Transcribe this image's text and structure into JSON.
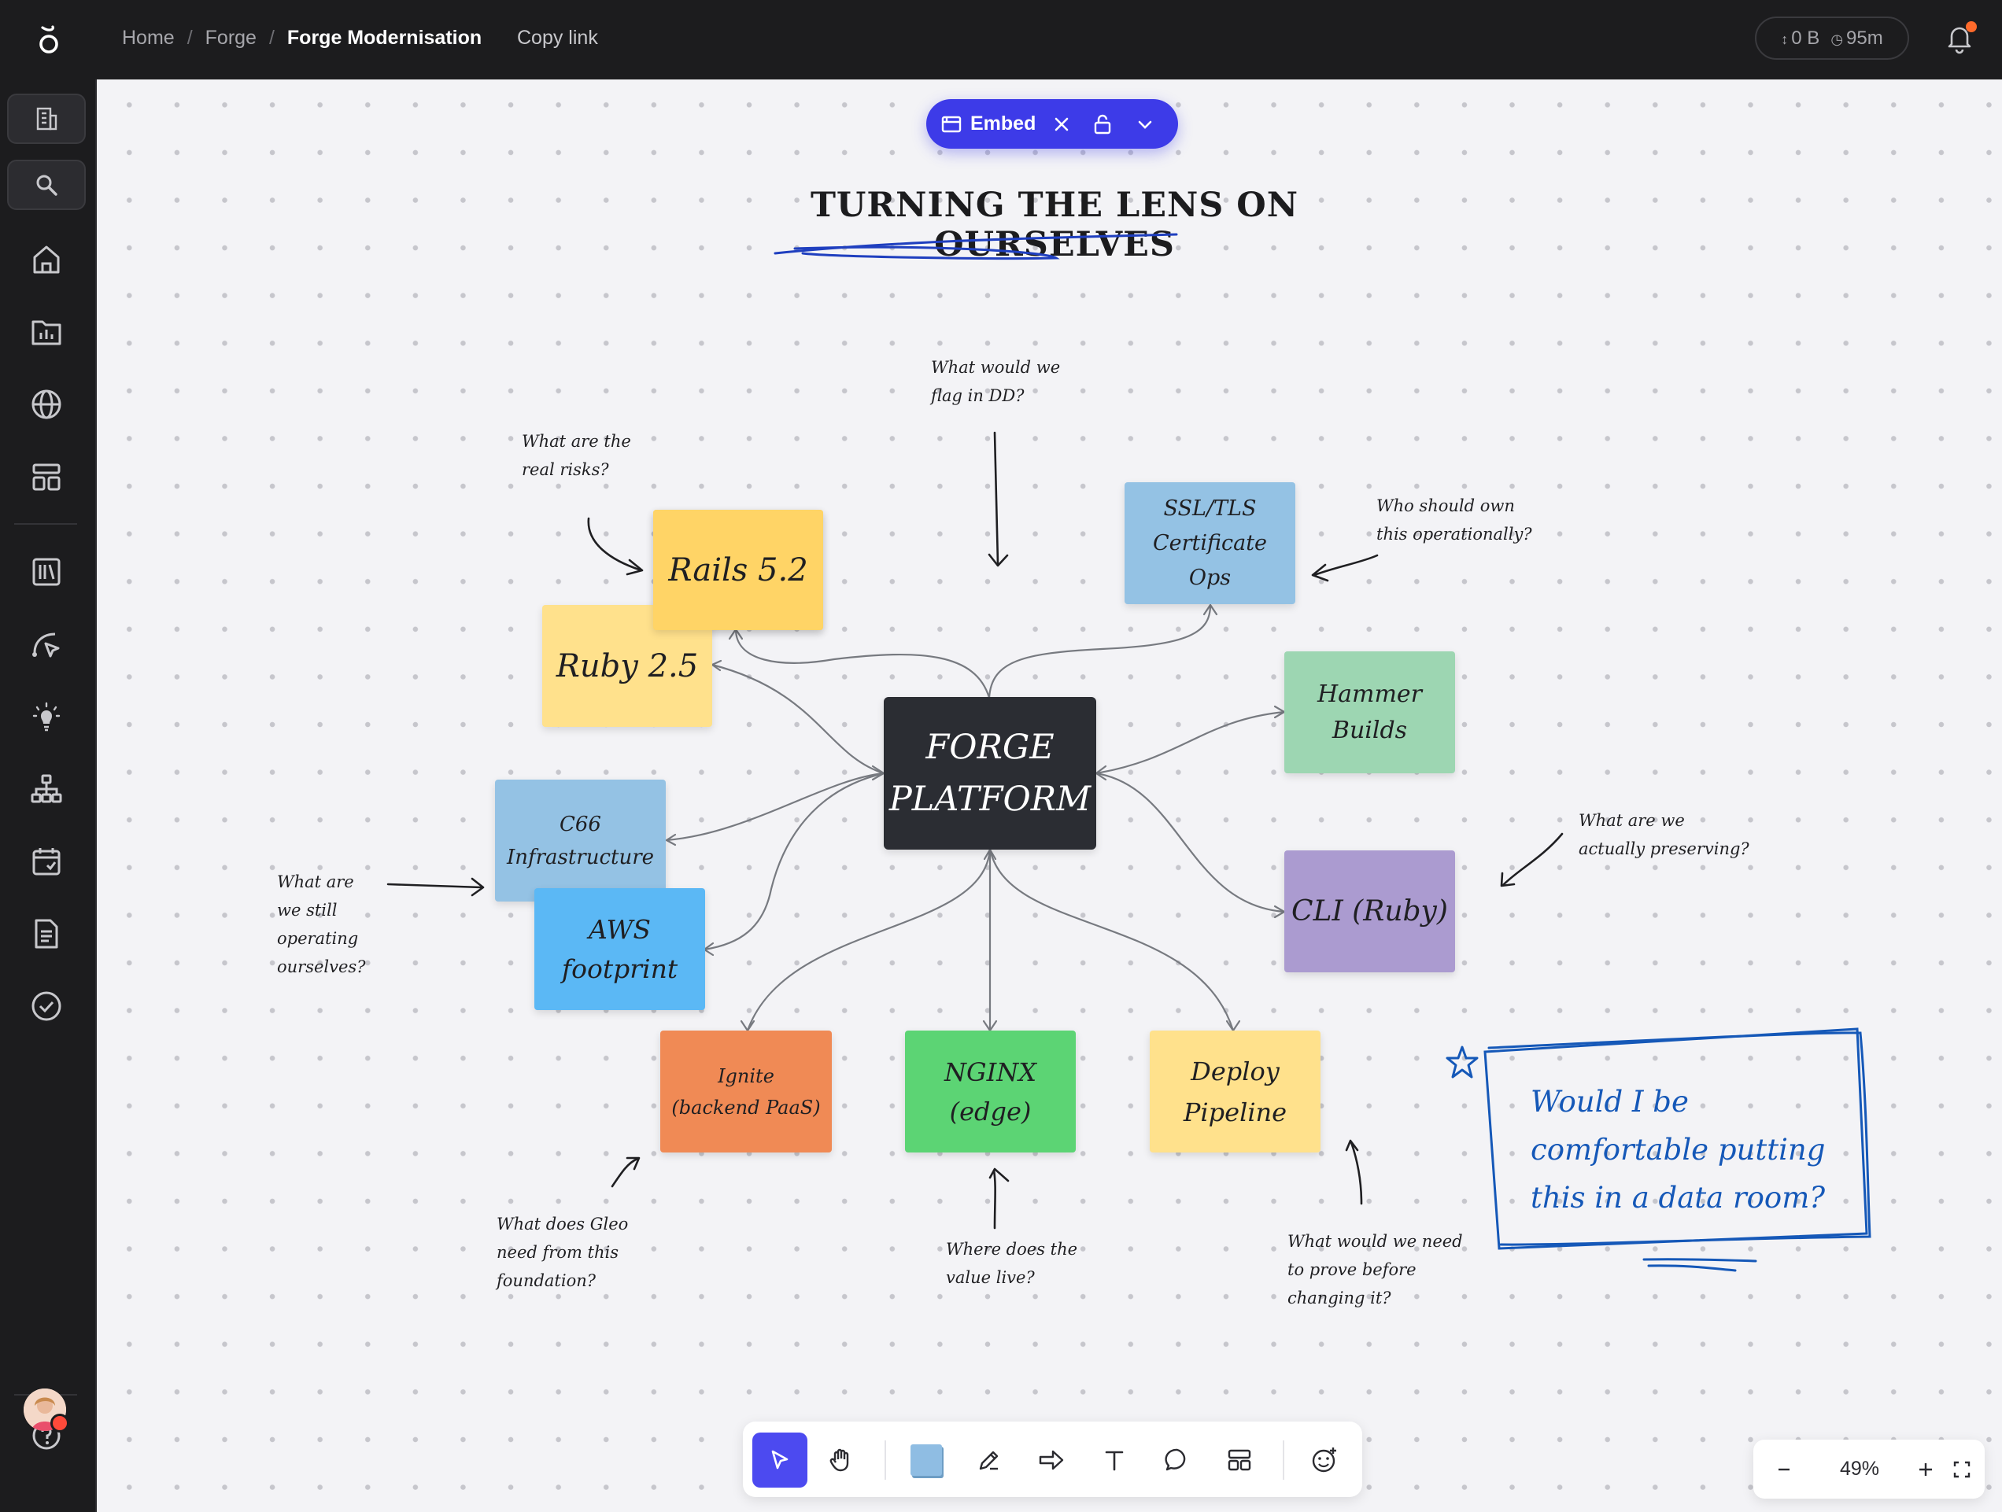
{
  "topbar": {
    "breadcrumb": [
      "Home",
      "Forge",
      "Forge Modernisation"
    ],
    "copy_link": "Copy link",
    "storage": "0 B",
    "time": "95m"
  },
  "canvas": {
    "embed_label": "Embed",
    "title": "TURNING THE LENS ON OURSELVES",
    "notes": {
      "center": [
        "FORGE",
        "PLATFORM"
      ],
      "rails": "Rails 5.2",
      "ruby": "Ruby 2.5",
      "ssl": [
        "SSL/TLS",
        "Certificate Ops"
      ],
      "hammer": [
        "Hammer",
        "Builds"
      ],
      "cli": "CLI (Ruby)",
      "c66": [
        "C66",
        "Infrastructure"
      ],
      "aws": [
        "AWS",
        "footprint"
      ],
      "ignite": [
        "Ignite",
        "(backend PaaS)"
      ],
      "nginx": [
        "NGINX",
        "(edge)"
      ],
      "deploy": [
        "Deploy",
        "Pipeline"
      ]
    },
    "annotations": {
      "dd": [
        "What would we",
        "flag in DD?"
      ],
      "risks": [
        "What are the",
        "real risks?"
      ],
      "own": [
        "Who should own",
        "this operationally?"
      ],
      "preserving": [
        "What are we",
        "actually preserving?"
      ],
      "operating": [
        "What are",
        "we still",
        "operating",
        "ourselves?"
      ],
      "gleo": [
        "What does Gleo",
        "need from this",
        "foundation?"
      ],
      "value": [
        "Where does the",
        "value live?"
      ],
      "prove": [
        "What would we need",
        "to prove before",
        "changing it?"
      ]
    },
    "callout": [
      "Would I be",
      "comfortable putting",
      "this in a data room?"
    ]
  },
  "toolbar": {
    "tools": [
      "select-tool",
      "hand-tool",
      "sticky-note-tool",
      "pen-tool",
      "arrow-tool",
      "text-tool",
      "comment-tool",
      "template-tool",
      "emoji-tool"
    ]
  },
  "zoom": {
    "level": "49%"
  },
  "colors": {
    "accent": "#3d3be8",
    "note_dark": "#2b2d33",
    "note_yellow_dark": "#ffd466",
    "note_yellow_light": "#ffe18c",
    "note_blue": "#94c2e4",
    "note_sky": "#5bb8f5",
    "note_green": "#9dd6b2",
    "note_bright_green": "#5cd474",
    "note_purple": "#ab9bd0",
    "note_orange": "#f08a55",
    "callout_blue": "#1558b8"
  }
}
